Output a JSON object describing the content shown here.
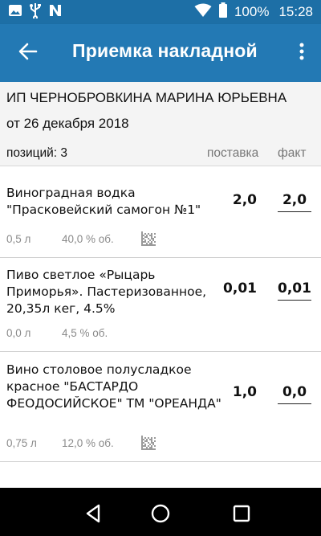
{
  "status_bar": {
    "icons": [
      "image-icon",
      "usb-icon",
      "n-icon",
      "wifi-icon",
      "battery-icon"
    ],
    "battery": "100%",
    "time": "15:28"
  },
  "app_bar": {
    "back_icon": "arrow-left-icon",
    "title": "Приемка накладной",
    "menu_icon": "more-vert-icon"
  },
  "header": {
    "supplier": "ИП ЧЕРНОБРОВКИНА МАРИНА ЮРЬЕВНА",
    "date": "от 26 декабря 2018",
    "positions": "позиций: 3",
    "col_delivery": "поставка",
    "col_fact": "факт"
  },
  "items": [
    {
      "name": "Виноградная водка \"Прасковейский самогон №1\"",
      "delivery": "2,0",
      "fact": "2,0",
      "volume": "0,5 л",
      "abv": "40,0 % об.",
      "has_code": true
    },
    {
      "name": "Пиво светлое «Рыцарь Приморья». Пастеризованное, 20,35л кег, 4.5%",
      "delivery": "0,01",
      "fact": "0,01",
      "volume": "0,0 л",
      "abv": "4,5 % об.",
      "has_code": false
    },
    {
      "name": "Вино столовое полусладкое красное \"БАСТАРДО ФЕОДОСИЙСКОЕ\" ТМ \"ОРЕАНДА\"",
      "delivery": "1,0",
      "fact": "0,0",
      "volume": "0,75 л",
      "abv": "12,0 % об.",
      "has_code": true
    }
  ],
  "nav_bar": {
    "buttons": [
      "back-triangle-icon",
      "home-circle-icon",
      "recents-square-icon"
    ]
  },
  "colors": {
    "status_bar": "#1d6fa6",
    "app_bar": "#2379b4",
    "header_bg": "#f4f4f4"
  }
}
